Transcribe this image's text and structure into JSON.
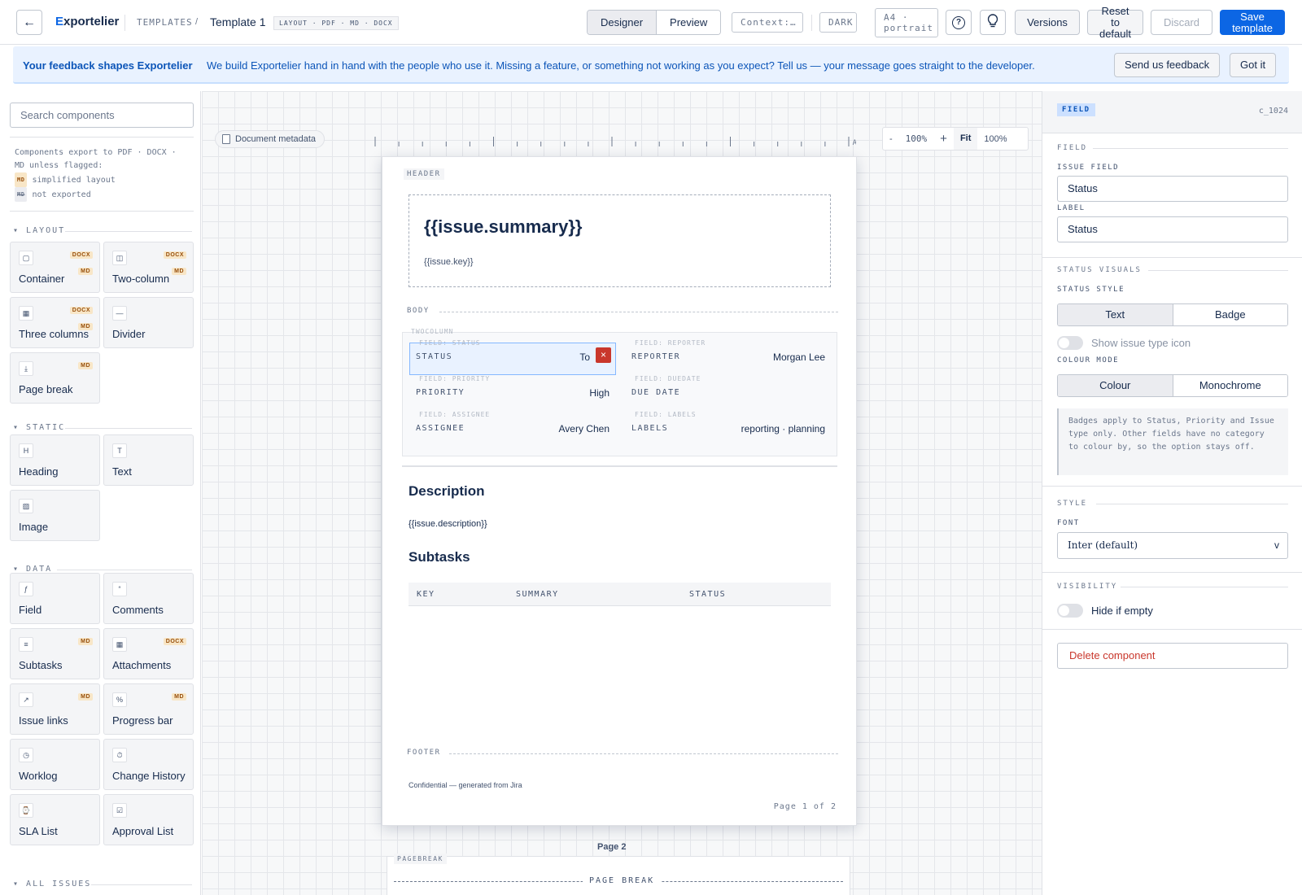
{
  "topbar": {
    "back_icon": "arrow-left-icon",
    "brand_first": "E",
    "brand_rest": "xportelier",
    "crumb": "TEMPLATES",
    "crumb_sep": "/",
    "template_name": "Template 1",
    "formats": "LAYOUT · PDF · MD · DOCX",
    "mode_tabs": [
      {
        "label": "Designer",
        "active": true
      },
      {
        "label": "Preview",
        "active": false
      }
    ],
    "context": "Context:…",
    "theme": "DARK",
    "page_size_line1": "A4 ·",
    "page_size_line2": "portrait",
    "help_icon": "question-circle-icon",
    "tip_icon": "lightbulb-icon",
    "versions": "Versions",
    "reset_line1": "Reset",
    "reset_line2": "to",
    "reset_line3": "default",
    "discard": "Discard",
    "save_line1": "Save",
    "save_line2": "template"
  },
  "banner": {
    "title": "Your feedback shapes Exportelier",
    "message": "We build Exportelier hand in hand with the people who use it. Missing a feature, or something not working as you expect? Tell us — your message goes straight to the developer.",
    "feedback_button": "Send us feedback",
    "dismiss_button": "Got it"
  },
  "sidebar": {
    "search_placeholder": "Search components",
    "legend_line1": "Components export to PDF · DOCX ·",
    "legend_line2": "MD unless flagged:",
    "legend_md_tag": "MD",
    "legend_md_text": "simplified layout",
    "legend_na_tag": "MD",
    "legend_na_text": "not exported",
    "sections": {
      "layout": "LAYOUT",
      "static": "STATIC",
      "data": "DATA",
      "all_issues": "ALL ISSUES"
    },
    "layout_items": [
      {
        "label": "Container",
        "icon": "▢",
        "tag1": "DOCX",
        "tag2": "MD"
      },
      {
        "label": "Two-column",
        "icon": "◫",
        "tag1": "DOCX",
        "tag2": "MD"
      },
      {
        "label": "Three columns",
        "icon": "▦",
        "tag1": "DOCX",
        "tag2": "MD"
      },
      {
        "label": "Divider",
        "icon": "—"
      },
      {
        "label": "Page break",
        "icon": "⤓",
        "tag1": "MD"
      }
    ],
    "static_items": [
      {
        "label": "Heading",
        "icon": "H"
      },
      {
        "label": "Text",
        "icon": "T"
      },
      {
        "label": "Image",
        "icon": "▨"
      }
    ],
    "data_items": [
      {
        "label": "Field",
        "icon": "ƒ"
      },
      {
        "label": "Comments",
        "icon": "“"
      },
      {
        "label": "Subtasks",
        "icon": "≡",
        "tag1": "MD"
      },
      {
        "label": "Attachments",
        "icon": "▦",
        "tag1": "DOCX"
      },
      {
        "label": "Issue links",
        "icon": "↗",
        "tag1": "MD"
      },
      {
        "label": "Progress bar",
        "icon": "%",
        "tag1": "MD"
      },
      {
        "label": "Worklog",
        "icon": "◷"
      },
      {
        "label": "Change History",
        "icon": "⏱"
      },
      {
        "label": "SLA List",
        "icon": "⌚"
      },
      {
        "label": "Approval List",
        "icon": "☑"
      }
    ]
  },
  "canvas": {
    "metadata_button": "Document metadata",
    "ruler_marker": "A",
    "zoom_out": "-",
    "zoom_level": "100%",
    "zoom_in": "+",
    "fit": "Fit",
    "fit_level": "100%",
    "page": {
      "header_label": "HEADER",
      "summary": "{{issue.summary}}",
      "key": "{{issue.key}}",
      "body_label": "BODY",
      "twocolumn_label": "TWOCOLUMN",
      "left_fields": [
        {
          "tag": "FIELD: STATUS",
          "label": "STATUS",
          "value": "To"
        },
        {
          "tag": "FIELD: PRIORITY",
          "label": "PRIORITY",
          "value": "High"
        },
        {
          "tag": "FIELD: ASSIGNEE",
          "label": "ASSIGNEE",
          "value": "Avery Chen"
        }
      ],
      "right_fields": [
        {
          "tag": "FIELD: REPORTER",
          "label": "REPORTER",
          "value": "Morgan Lee"
        },
        {
          "tag": "FIELD: DUEDATE",
          "label": "DUE DATE",
          "value": ""
        },
        {
          "tag": "FIELD: LABELS",
          "label": "LABELS",
          "value": "reporting · planning"
        }
      ],
      "remove_icon": "×",
      "description_heading": "Description",
      "description_text": "{{issue.description}}",
      "subtasks_heading": "Subtasks",
      "subtasks_columns": [
        "KEY",
        "SUMMARY",
        "STATUS"
      ],
      "footer_label": "FOOTER",
      "footer_text": "Confidential — generated from Jira",
      "page_number": "Page 1 of 2"
    },
    "page2_label": "Page 2",
    "page2_tag": "PAGEBREAK",
    "page_break_text": "PAGE BREAK"
  },
  "inspector": {
    "type_tag": "FIELD",
    "component_id": "c_1024",
    "field_section": "FIELD",
    "issue_field_label": "ISSUE FIELD",
    "issue_field_value": "Status",
    "label_label": "LABEL",
    "label_value": "Status",
    "status_visuals_section": "STATUS VISUALS",
    "status_style_label": "STATUS STYLE",
    "status_style_options": [
      "Text",
      "Badge"
    ],
    "show_icon_label": "Show issue type icon",
    "colour_mode_label": "COLOUR MODE",
    "colour_mode_options": [
      "Colour",
      "Monochrome"
    ],
    "badge_note": "Badges apply to Status, Priority and Issue type only. Other fields have no category to colour by, so the option stays off.",
    "style_section": "STYLE",
    "font_label": "FONT",
    "font_value": "Inter (default)",
    "font_chevron": "v",
    "visibility_section": "VISIBILITY",
    "hide_if_empty_label": "Hide if empty",
    "delete_button": "Delete component"
  },
  "colors": {
    "accent": "#0c66e4",
    "banner_bg": "#e9f2ff",
    "danger": "#c9372c",
    "tag_bg": "#f8e6c7"
  }
}
